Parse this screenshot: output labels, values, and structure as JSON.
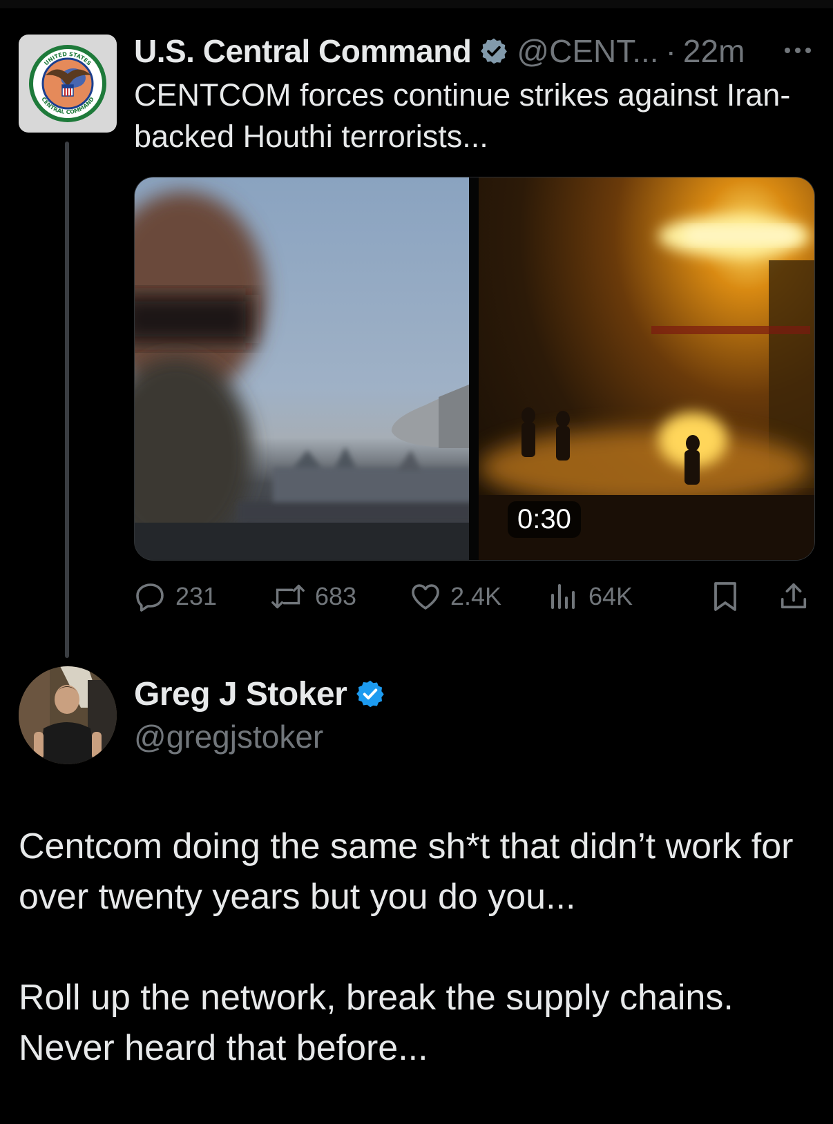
{
  "parent_tweet": {
    "display_name": "U.S. Central Command",
    "handle": "@CENT...",
    "separator": "·",
    "time": "22m",
    "text": "CENTCOM forces continue strikes against Iran-backed Houthi terrorists...",
    "avatar_icon": "centcom-seal-icon",
    "seal_text_top": "UNITED STATES",
    "seal_text_bottom": "CENTRAL COMMAND",
    "media": {
      "video_duration": "0:30"
    },
    "actions": {
      "replies": "231",
      "reposts": "683",
      "likes": "2.4K",
      "views": "64K"
    }
  },
  "reply_tweet": {
    "display_name": "Greg J Stoker",
    "handle": "@gregjstoker",
    "paragraphs": [
      "Centcom doing the same sh*t that didn’t work for over twenty years but you do you...",
      "Roll up the network, break the supply chains. Never heard that before..."
    ]
  },
  "colors": {
    "background": "#000000",
    "primary_text": "#e7e9ea",
    "secondary_text": "#71767b",
    "verified_blue": "#1d9bf0",
    "verified_gray": "#829aab"
  }
}
